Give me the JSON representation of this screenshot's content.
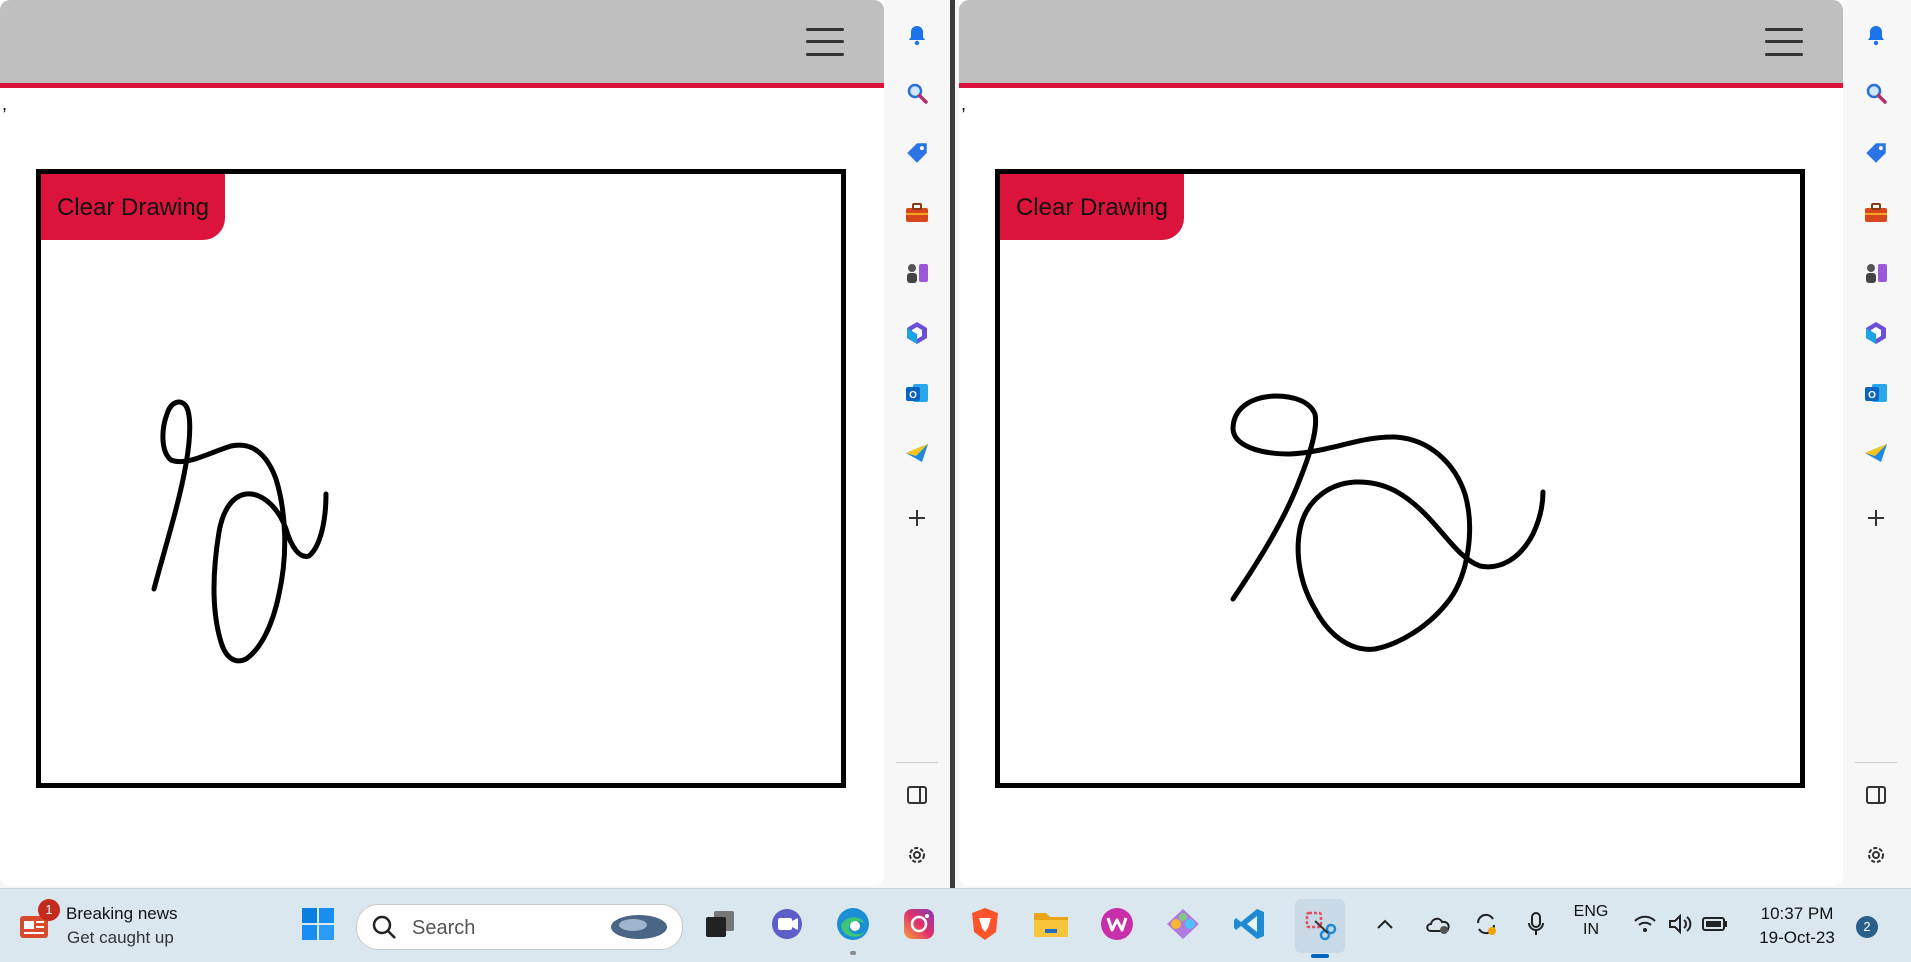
{
  "panes": [
    {
      "stray_text": ",",
      "clear_button_label": "Clear Drawing",
      "drawing_stroke": "#000000",
      "accent": "#dc143c"
    },
    {
      "stray_text": ",",
      "clear_button_label": "Clear Drawing",
      "drawing_stroke": "#000000",
      "accent": "#dc143c"
    }
  ],
  "edge_sidebar": {
    "icons": [
      "bell-icon",
      "search-icon",
      "tag-icon",
      "briefcase-icon",
      "games-icon",
      "microsoft365-icon",
      "outlook-icon",
      "send-icon",
      "add-icon"
    ],
    "bottom_icons": [
      "split-view-icon",
      "settings-icon"
    ]
  },
  "taskbar": {
    "news": {
      "title": "Breaking news",
      "subtitle": "Get caught up",
      "badge": "1"
    },
    "search_placeholder": "Search",
    "apps": [
      "windows-start",
      "task-view",
      "teams-chat",
      "edge",
      "instagram",
      "brave",
      "file-explorer",
      "wps-office",
      "git-app",
      "vscode",
      "snipping-tool"
    ],
    "tray": {
      "language_line1": "ENG",
      "language_line2": "IN",
      "time": "10:37 PM",
      "date": "19-Oct-23",
      "notifications": "2"
    }
  }
}
